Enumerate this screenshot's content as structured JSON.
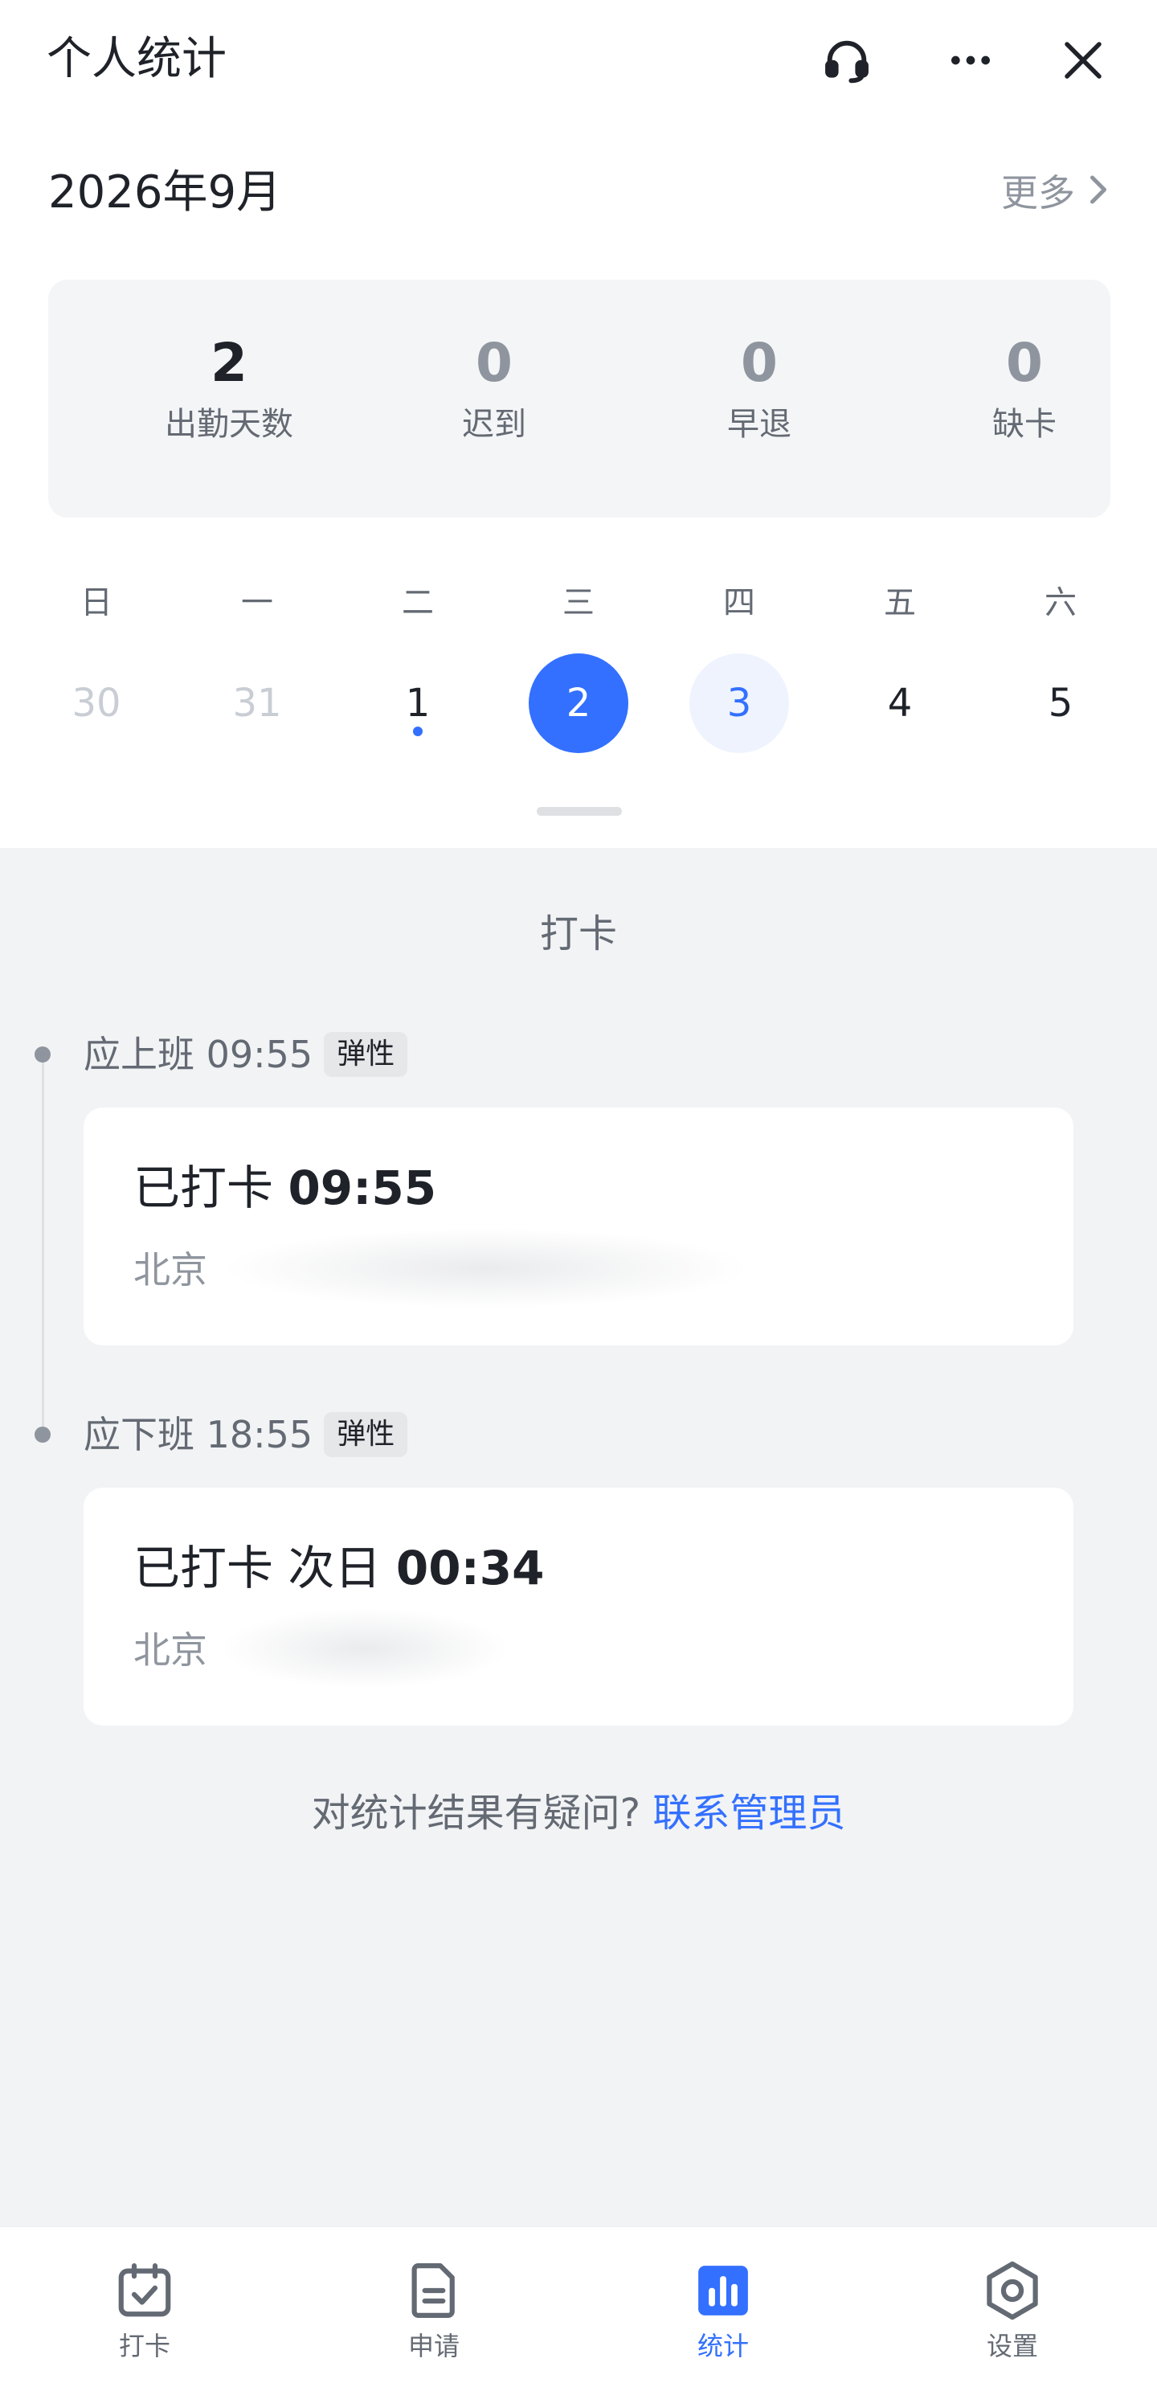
{
  "header": {
    "title": "个人统计",
    "icons": [
      "headset-icon",
      "more-icon",
      "close-icon"
    ]
  },
  "month": {
    "title": "2026年9月",
    "more_label": "更多"
  },
  "summary": {
    "stats": [
      {
        "value": "2",
        "label": "出勤天数"
      },
      {
        "value": "0",
        "label": "迟到"
      },
      {
        "value": "0",
        "label": "早退"
      },
      {
        "value": "0",
        "label": "缺卡"
      }
    ]
  },
  "calendar": {
    "weekdays": [
      "日",
      "一",
      "二",
      "三",
      "四",
      "五",
      "六"
    ],
    "days": [
      {
        "label": "30",
        "state": "muted"
      },
      {
        "label": "31",
        "state": "muted"
      },
      {
        "label": "1",
        "state": "normal",
        "has_dot": true
      },
      {
        "label": "2",
        "state": "selected"
      },
      {
        "label": "3",
        "state": "today"
      },
      {
        "label": "4",
        "state": "normal"
      },
      {
        "label": "5",
        "state": "normal"
      }
    ]
  },
  "section": {
    "title": "打卡"
  },
  "punches": [
    {
      "shift_label": "应上班 09:55",
      "badge": "弹性",
      "status": "已打卡",
      "time": "09:55",
      "location": "北京"
    },
    {
      "shift_label": "应下班 18:55",
      "badge": "弹性",
      "status": "已打卡 次日",
      "time": "00:34",
      "location": "北京"
    }
  ],
  "help": {
    "question": "对统计结果有疑问?",
    "link": "联系管理员"
  },
  "tabbar": {
    "tabs": [
      {
        "label": "打卡",
        "icon": "calendar-check-icon"
      },
      {
        "label": "申请",
        "icon": "document-icon"
      },
      {
        "label": "统计",
        "icon": "bar-chart-icon",
        "active": true
      },
      {
        "label": "设置",
        "icon": "gear-icon"
      }
    ]
  },
  "colors": {
    "accent": "#3370ff",
    "today_bg": "#eef3fe",
    "page_bg": "#f2f3f5",
    "card_bg": "#ffffff"
  }
}
